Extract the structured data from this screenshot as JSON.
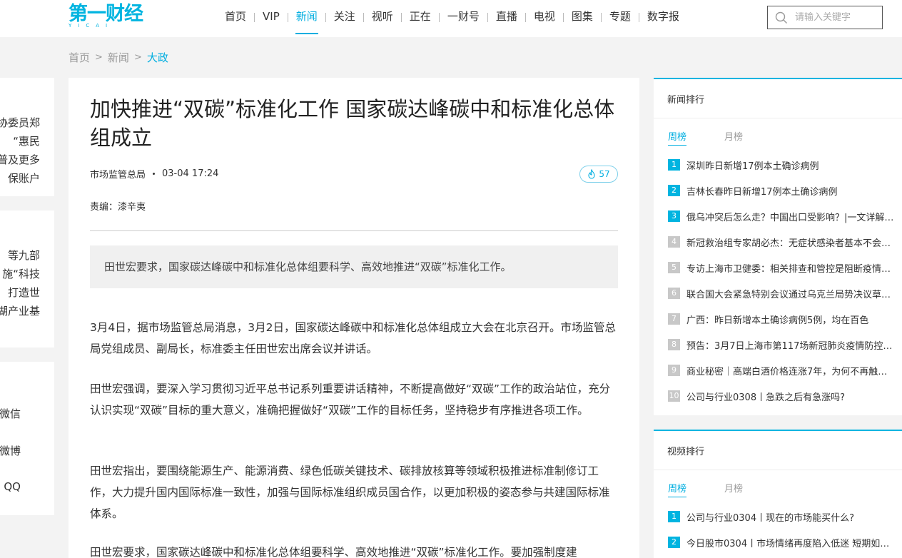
{
  "header": {
    "logo_text": "第一财经",
    "logo_sub": "YICAI",
    "brand_color": "#00b4e0",
    "nav": [
      "首页",
      "VIP",
      "新闻",
      "关注",
      "视听",
      "正在",
      "一财号",
      "直播",
      "电视",
      "图集",
      "专题",
      "数字报"
    ],
    "active_nav": "新闻",
    "search_placeholder": "请输入关键字"
  },
  "breadcrumb": [
    "首页",
    "新闻",
    "大政"
  ],
  "left_cards": {
    "card1": [
      "协委员郑",
      "“惠民",
      "普及更多",
      "保账户"
    ],
    "card2": [
      "等九部",
      "施“科技",
      "打造世",
      "湖产业基"
    ],
    "share": [
      "微信",
      "微博",
      "QQ"
    ]
  },
  "article": {
    "title": "加快推进“双碳”标准化工作 国家碳达峰碳中和标准化总体组成立",
    "source": "市场监管总局",
    "time": "03-04 17:24",
    "likes": "57",
    "editor": "责编：漆辛夷",
    "summary": "田世宏要求，国家碳达峰碳中和标准化总体组要科学、高效地推进“双碳”标准化工作。",
    "paragraphs": [
      "3月4日，据市场监管总局消息，3月2日，国家碳达峰碳中和标准化总体组成立大会在北京召开。市场监管总局党组成员、副局长，标准委主任田世宏出席会议并讲话。",
      "田世宏强调，要深入学习贯彻习近平总书记系列重要讲话精神，不断提高做好“双碳”工作的政治站位，充分认识实现“双碳”目标的重大意义，准确把握做好“双碳”工作的目标任务，坚持稳步有序推进各项工作。",
      "田世宏指出，要围绕能源生产、能源消费、绿色低碳关键技术、碳排放核算等领域积极推进标准制修订工作，大力提升国内国际标准一致性，加强与国际标准组织成员国合作，以更加积极的姿态参与共建国际标准体系。",
      "田世宏要求，国家碳达峰碳中和标准化总体组要科学、高效地推进“双碳”标准化工作。要加强制度建"
    ]
  },
  "news_rank": {
    "title": "新闻排行",
    "tabs": [
      "周榜",
      "月榜"
    ],
    "active_tab": "周榜",
    "items": [
      {
        "num": "1",
        "text": "深圳昨日新增17例本土确诊病例"
      },
      {
        "num": "2",
        "text": "吉林长春昨日新增17例本土确诊病例"
      },
      {
        "num": "3",
        "text": "俄乌冲突后怎么走？中国出口受影响？|一文详解…"
      },
      {
        "num": "4",
        "text": "新冠救治组专家胡必杰：无症状感染者基本不会…"
      },
      {
        "num": "5",
        "text": "专访上海市卫健委：相关排查和管控是阻断疫情…"
      },
      {
        "num": "6",
        "text": "联合国大会紧急特别会议通过乌克兰局势决议草…"
      },
      {
        "num": "7",
        "text": "广西：昨日新增本土确诊病例5例，均在百色"
      },
      {
        "num": "8",
        "text": "预告：3月7日上海市第117场新冠肺炎疫情防控…"
      },
      {
        "num": "9",
        "text": "商业秘密｜高端白酒价格连涨7年，为何不再触…"
      },
      {
        "num": "10",
        "text": "公司与行业0308丨急跌之后有急涨吗?"
      }
    ]
  },
  "video_rank": {
    "title": "视频排行",
    "tabs": [
      "周榜",
      "月榜"
    ],
    "active_tab": "周榜",
    "items": [
      {
        "num": "1",
        "text": "公司与行业0304丨现在的市场能买什么?"
      },
      {
        "num": "2",
        "text": "今日股市0304丨市场情绪再度陷入低迷 短期如…"
      }
    ]
  }
}
